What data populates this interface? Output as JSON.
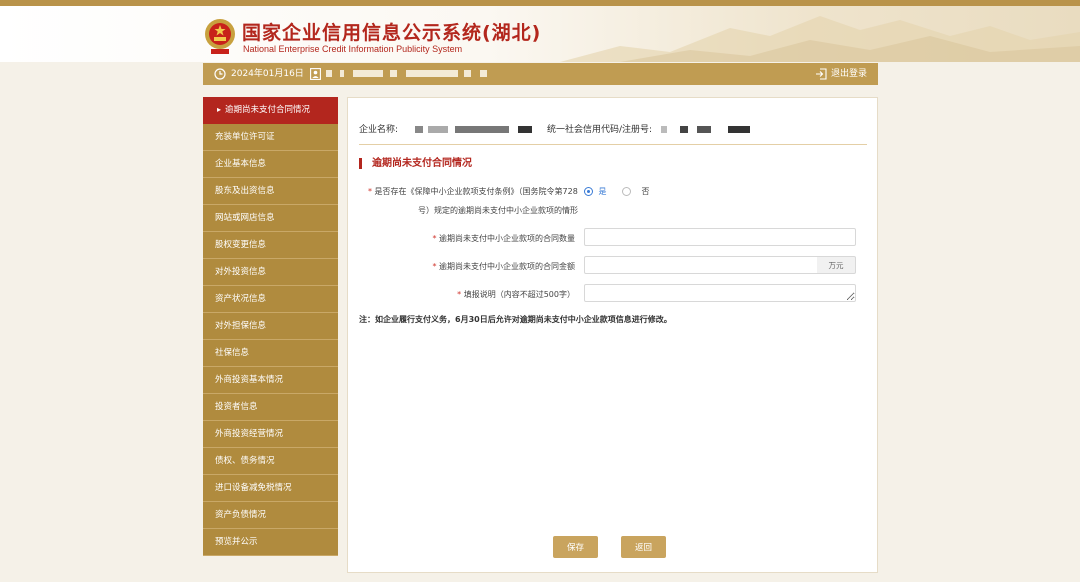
{
  "header": {
    "title": "国家企业信用信息公示系统(湖北)",
    "subtitle": "National Enterprise Credit Information Publicity System"
  },
  "userbar": {
    "date": "2024年01月16日",
    "logout_label": "退出登录"
  },
  "sidebar": {
    "items": [
      {
        "label": "逾期尚未支付合同情况",
        "active": true
      },
      {
        "label": "充装单位许可证"
      },
      {
        "label": "企业基本信息"
      },
      {
        "label": "股东及出资信息"
      },
      {
        "label": "网站或网店信息"
      },
      {
        "label": "股权变更信息"
      },
      {
        "label": "对外投资信息"
      },
      {
        "label": "资产状况信息"
      },
      {
        "label": "对外担保信息"
      },
      {
        "label": "社保信息"
      },
      {
        "label": "外商投资基本情况"
      },
      {
        "label": "投资者信息"
      },
      {
        "label": "外商投资经营情况"
      },
      {
        "label": "债权、债务情况"
      },
      {
        "label": "进口设备减免税情况"
      },
      {
        "label": "资产负债情况"
      },
      {
        "label": "预览并公示"
      }
    ]
  },
  "main": {
    "company_label": "企业名称:",
    "credit_code_label": "统一社会信用代码/注册号:",
    "section_title": "逾期尚未支付合同情况",
    "question": {
      "line1": "是否存在《保障中小企业款项支付条例》（国务院令第728",
      "line2": "号）规定的逾期尚未支付中小企业款项的情形",
      "options": {
        "yes": "是",
        "no": "否"
      },
      "selected": "yes"
    },
    "fields": {
      "count_label": "逾期尚未支付中小企业款项的合同数量",
      "count_value": "",
      "amount_label": "逾期尚未支付中小企业款项的合同金额",
      "amount_value": "",
      "amount_unit": "万元",
      "remark_label": "填报说明（内容不超过500字）",
      "remark_value": ""
    },
    "note": "注：如企业履行支付义务，6月30日后允许对逾期尚未支付中小企业款项信息进行修改。",
    "buttons": {
      "save": "保存",
      "back": "返回"
    }
  },
  "colors": {
    "brand_red": "#b3261e",
    "gold": "#b08b3e",
    "bar_gold": "#c09c52",
    "button_gold": "#c9a45e",
    "radio_blue": "#3a7bd5"
  }
}
